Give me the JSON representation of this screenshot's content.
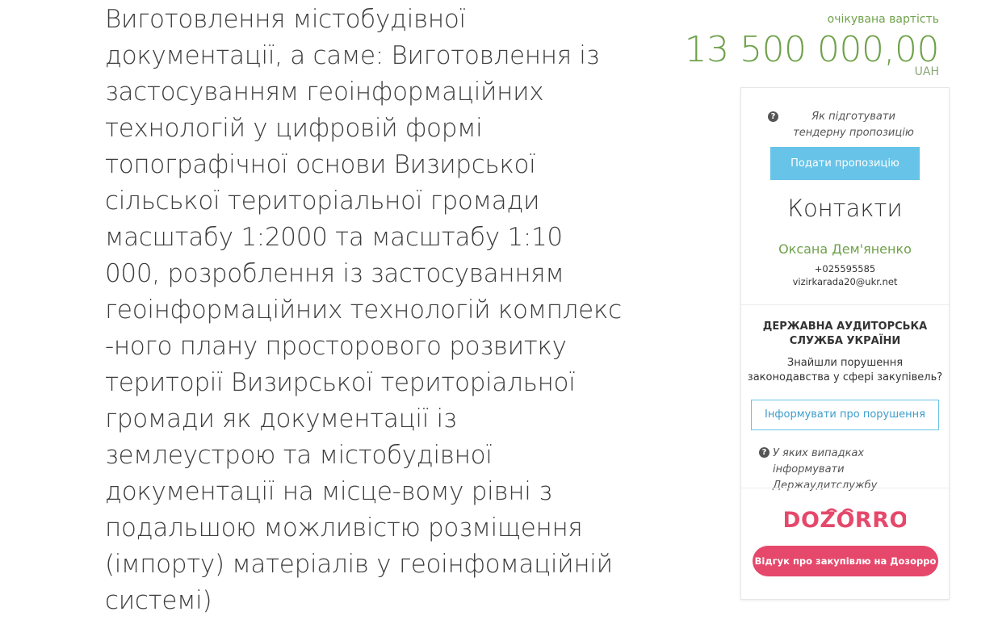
{
  "tender": {
    "title": "Виготовлення містобудівної документації, а саме: Виготовлення із застосуванням геоінформаційних технологій у цифровій формі топографічної основи Визирської сільської територіальної громади масштабу 1:2000 та масштабу 1:10 000, розроблення із застосуванням геоінформаційних технологій комплекс -ного плану просторового розвитку території Визирської територіальної громади як документації із землеустрою та містобудівної документації на місце-вому рівні з подальшою можливістю розміщення (імпорту) матеріалів у геоінфомаційній системі)"
  },
  "price": {
    "label": "очікувана вартість",
    "amount": "13 500 000,00",
    "currency": "UAH"
  },
  "sidebar": {
    "help_prepare": "Як підготувати тендерну пропозицію",
    "submit_label": "Подати пропозицію",
    "contacts_title": "Контакти",
    "contact": {
      "name": "Оксана Дем'яненко",
      "phone": "+025595585",
      "email": "vizirkarada20@ukr.net"
    },
    "audit": {
      "title_line1": "ДЕРЖАВНА АУДИТОРСЬКА",
      "title_line2": "СЛУЖБА УКРАЇНИ",
      "question_line1": "Знайшли порушення",
      "question_line2": "законодавства у сфері закупівель?",
      "report_label": "Інформувати про порушення",
      "help_cases": "У яких випадках інформувати Держаудитслужбу"
    },
    "dozorro": {
      "logo_text": "DOZORRO",
      "feedback_label": "Відгук про закупівлю на Дозорро"
    }
  },
  "colors": {
    "price_green": "#6fa14a",
    "submit_blue": "#67c3e8",
    "dozorro_pink": "#e5486b"
  }
}
